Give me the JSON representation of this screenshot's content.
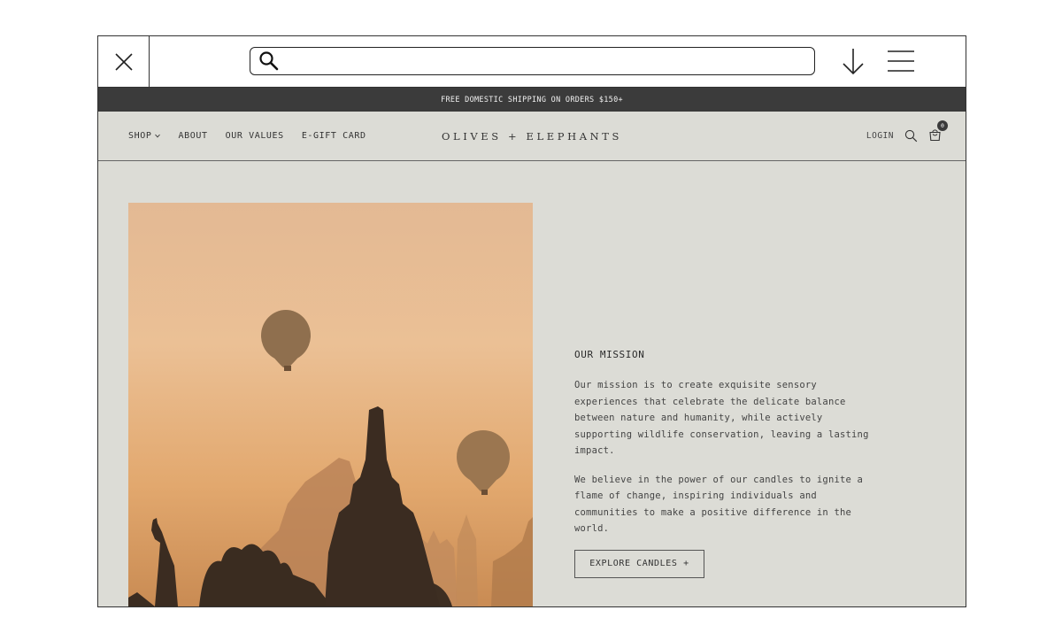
{
  "browser": {
    "search_value": "",
    "close_icon": "close-icon",
    "download_icon": "download-arrow-icon",
    "menu_icon": "hamburger-menu-icon"
  },
  "announcement": "FREE DOMESTIC SHIPPING ON ORDERS $150+",
  "header": {
    "nav": [
      "SHOP",
      "ABOUT",
      "OUR VALUES",
      "E-GIFT CARD"
    ],
    "logo": "OLIVES + ELEPHANTS",
    "login": "LOGIN",
    "cart_count": "0"
  },
  "mission": {
    "title": "OUR MISSION",
    "paragraph_1": "Our mission is to create exquisite sensory experiences that celebrate the delicate balance between nature and humanity, while actively supporting wildlife conservation, leaving a lasting impact.",
    "paragraph_2": "We believe in the power of our candles to ignite a flame of change, inspiring individuals and communities to make a positive difference in the world.",
    "cta": "EXPLORE CANDLES +"
  },
  "colors": {
    "announcement_bg": "#3b3b3b",
    "page_bg": "#dcdcd6",
    "accent_text": "#2b2b2b"
  }
}
